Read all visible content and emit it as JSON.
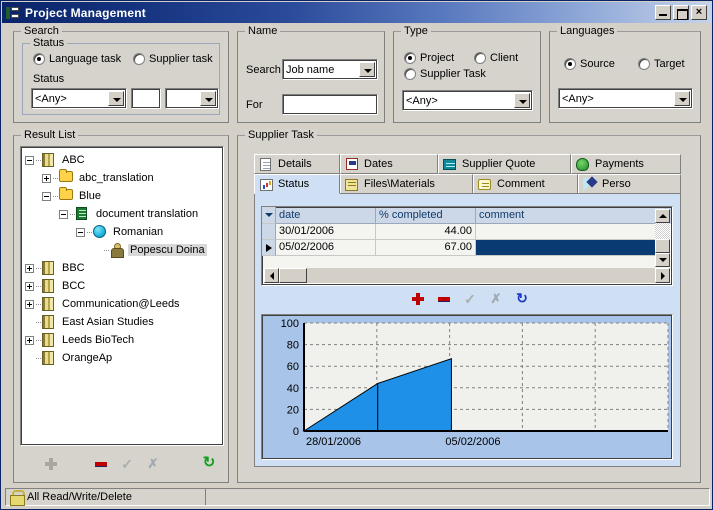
{
  "window": {
    "title": "Project Management",
    "icon": "app-icon",
    "minimize_label": "",
    "maximize_label": "",
    "close_label": "×"
  },
  "search": {
    "caption": "Search",
    "status_group": {
      "caption": "Status",
      "radios": [
        {
          "label": "Language task",
          "selected": true
        },
        {
          "label": "Supplier task",
          "selected": false
        }
      ],
      "field_label": "Status",
      "combo_value": "<Any>",
      "small_text_value": "",
      "second_combo_value": ""
    }
  },
  "name": {
    "caption": "Name",
    "search_label": "Search",
    "search_combo_value": "Job name",
    "for_label": "For",
    "for_value": ""
  },
  "type": {
    "caption": "Type",
    "radios": [
      {
        "label": "Project",
        "selected": true
      },
      {
        "label": "Client",
        "selected": false
      },
      {
        "label": "Supplier Task",
        "selected": false
      }
    ],
    "combo_value": "<Any>"
  },
  "languages": {
    "caption": "Languages",
    "radios": [
      {
        "label": "Source",
        "selected": true
      },
      {
        "label": "Target",
        "selected": false
      }
    ],
    "combo_value": "<Any>"
  },
  "result_list": {
    "caption": "Result List",
    "nodes": [
      {
        "label": "ABC",
        "icon": "building-icon",
        "depth": 0,
        "expander": "minus",
        "selected": false
      },
      {
        "label": "abc_translation",
        "icon": "folder-icon",
        "depth": 1,
        "expander": "plus",
        "selected": false
      },
      {
        "label": "Blue",
        "icon": "folder-icon",
        "depth": 1,
        "expander": "minus",
        "selected": false
      },
      {
        "label": "document translation",
        "icon": "book-icon",
        "depth": 2,
        "expander": "minus",
        "selected": false
      },
      {
        "label": "Romanian",
        "icon": "globe-icon",
        "depth": 3,
        "expander": "minus",
        "selected": false
      },
      {
        "label": "Popescu Doina",
        "icon": "person-icon",
        "depth": 4,
        "expander": "none",
        "selected": true
      },
      {
        "label": "BBC",
        "icon": "building-icon",
        "depth": 0,
        "expander": "plus",
        "selected": false
      },
      {
        "label": "BCC",
        "icon": "building-icon",
        "depth": 0,
        "expander": "plus",
        "selected": false
      },
      {
        "label": "Communication@Leeds",
        "icon": "building-icon",
        "depth": 0,
        "expander": "plus",
        "selected": false
      },
      {
        "label": "East Asian Studies",
        "icon": "building-icon",
        "depth": 0,
        "expander": "none",
        "selected": false
      },
      {
        "label": "Leeds BioTech",
        "icon": "building-icon",
        "depth": 0,
        "expander": "plus",
        "selected": false
      },
      {
        "label": "OrangeAp",
        "icon": "building-icon",
        "depth": 0,
        "expander": "none",
        "selected": false
      }
    ],
    "navigator": [
      {
        "name": "add",
        "glyph": "+",
        "enabled": false
      },
      {
        "name": "delete",
        "glyph": "–",
        "enabled": true
      },
      {
        "name": "post",
        "glyph": "✓",
        "enabled": false
      },
      {
        "name": "cancel",
        "glyph": "✗",
        "enabled": false
      },
      {
        "name": "refresh",
        "glyph": "↻",
        "enabled": true
      }
    ]
  },
  "supplier_task": {
    "caption": "Supplier Task",
    "tabs_row1": [
      {
        "label": "Details",
        "icon": "details-icon",
        "active": false
      },
      {
        "label": "Dates",
        "icon": "dates-icon",
        "active": false
      },
      {
        "label": "Supplier Quote",
        "icon": "quote-icon",
        "active": false
      },
      {
        "label": "Payments",
        "icon": "payments-icon",
        "active": false
      }
    ],
    "tabs_row2": [
      {
        "label": "Status",
        "icon": "status-icon",
        "active": true
      },
      {
        "label": "Files\\Materials",
        "icon": "files-icon",
        "active": false
      },
      {
        "label": "Comment",
        "icon": "comment-icon",
        "active": false
      },
      {
        "label": "Perso",
        "icon": "perso-icon",
        "active": false
      }
    ],
    "grid": {
      "columns": [
        "date",
        "% completed",
        "comment"
      ],
      "rows": [
        {
          "date": "30/01/2006",
          "percent": "44.00",
          "comment": "",
          "current": false,
          "selected": false
        },
        {
          "date": "05/02/2006",
          "percent": "67.00",
          "comment": "",
          "current": true,
          "selected": true
        }
      ]
    },
    "navigator": [
      {
        "name": "add",
        "glyph": "+",
        "enabled": true
      },
      {
        "name": "delete",
        "glyph": "–",
        "enabled": true
      },
      {
        "name": "post",
        "glyph": "✓",
        "enabled": false
      },
      {
        "name": "cancel",
        "glyph": "✗",
        "enabled": false
      },
      {
        "name": "refresh",
        "glyph": "↻",
        "enabled": true
      }
    ]
  },
  "statusbar": {
    "icon": "permissions-icon",
    "text": "All Read/Write/Delete"
  },
  "chart_data": {
    "type": "area",
    "title": "",
    "xlabel": "",
    "ylabel": "",
    "x": [
      "28/01/2006",
      "30/01/2006",
      "05/02/2006"
    ],
    "values": [
      0,
      44,
      67
    ],
    "tick_labels_x": [
      "28/01/2006",
      "05/02/2006"
    ],
    "tick_labels_y": [
      "0",
      "20",
      "40",
      "60",
      "80",
      "100"
    ],
    "ylim": [
      0,
      100
    ],
    "grid": true,
    "legend": "none",
    "series_color": "#1e90e8",
    "plot_bg": "#f0f0ec",
    "panel_bg": "#a8c4e8"
  }
}
